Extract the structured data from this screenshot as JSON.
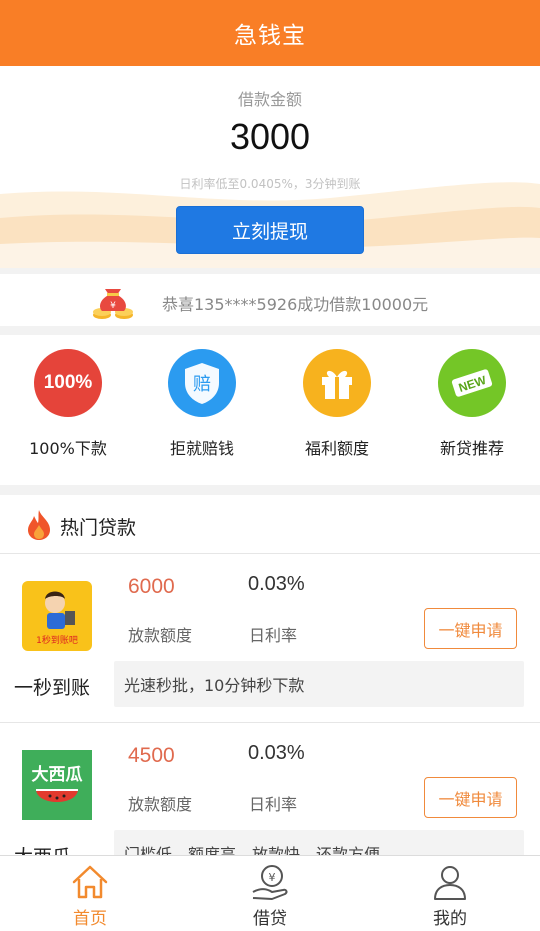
{
  "header": {
    "title": "急钱宝"
  },
  "hero": {
    "label": "借款金额",
    "amount": "3000",
    "rate_text": "日利率低至0.0405%，3分钟到账",
    "button_label": "立刻提现"
  },
  "notice": {
    "text": "恭喜135****5926成功借款10000元"
  },
  "features": [
    {
      "label": "100%下款",
      "badge": "100%",
      "color": "#e5443a"
    },
    {
      "label": "拒就赔钱",
      "badge": "赔",
      "color": "#2b9bf0"
    },
    {
      "label": "福利额度",
      "badge": "",
      "color": "#f7b21e"
    },
    {
      "label": "新贷推荐",
      "badge": "NEW",
      "color": "#74c627"
    }
  ],
  "hot": {
    "title": "热门贷款",
    "amount_label": "放款额度",
    "rate_label": "日利率",
    "apply_label": "一键申请",
    "items": [
      {
        "name": "一秒到账",
        "amount": "6000",
        "rate": "0.03%",
        "desc": "光速秒批，10分钟秒下款",
        "logo_text": "1秒到账吧"
      },
      {
        "name": "大西瓜",
        "amount": "4500",
        "rate": "0.03%",
        "desc": "门槛低，额度高，放款快，还款方便",
        "logo_text": "大西瓜"
      }
    ]
  },
  "tabbar": [
    {
      "label": "首页",
      "icon": "home-icon",
      "active": true
    },
    {
      "label": "借贷",
      "icon": "loan-icon",
      "active": false
    },
    {
      "label": "我的",
      "icon": "user-icon",
      "active": false
    }
  ],
  "colors": {
    "primary": "#f97e26",
    "button": "#1f79e3",
    "amount": "#e06a4e"
  }
}
